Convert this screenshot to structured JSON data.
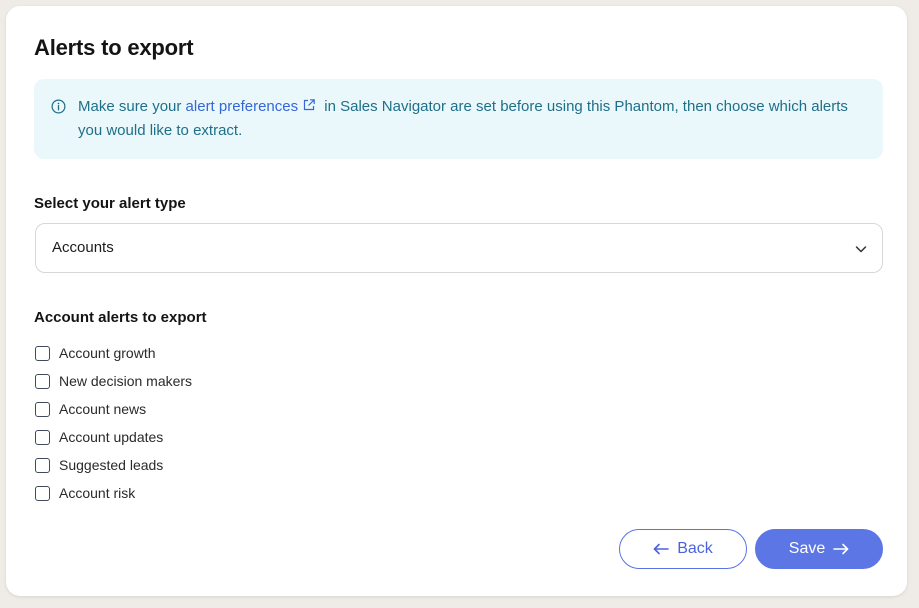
{
  "panel": {
    "title": "Alerts to export"
  },
  "info": {
    "prefix": "Make sure your ",
    "link_text": "alert preferences",
    "suffix": " in Sales Navigator are set before using this Phantom, then choose which alerts you would like to extract.",
    "icon": "info-icon",
    "link_icon": "external-link-icon"
  },
  "alert_type": {
    "label": "Select your alert type",
    "value": "Accounts",
    "icon": "chevron-down-icon"
  },
  "alerts": {
    "label": "Account alerts to export",
    "options": [
      {
        "label": "Account growth",
        "checked": false
      },
      {
        "label": "New decision makers",
        "checked": false
      },
      {
        "label": "Account news",
        "checked": false
      },
      {
        "label": "Account updates",
        "checked": false
      },
      {
        "label": "Suggested leads",
        "checked": false
      },
      {
        "label": "Account risk",
        "checked": false
      }
    ]
  },
  "actions": {
    "back_label": "Back",
    "save_label": "Save",
    "back_icon": "arrow-left-icon",
    "save_icon": "arrow-right-icon"
  },
  "colors": {
    "accent": "#5c76e6",
    "info_bg": "#eaf8fb",
    "info_text": "#1f6f88",
    "link": "#3567d6"
  }
}
